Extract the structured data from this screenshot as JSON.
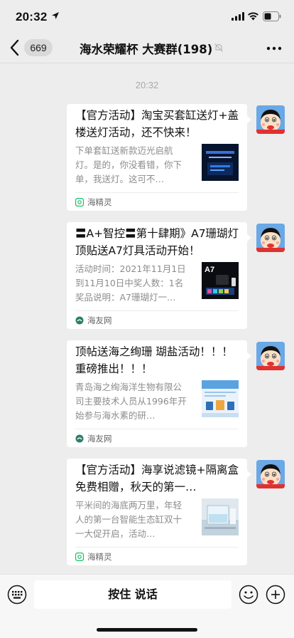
{
  "status_bar": {
    "time": "20:32"
  },
  "nav": {
    "back_label": "",
    "unread_count": "669",
    "title": "海水荣耀杯 大赛群(198)"
  },
  "timestamp": "20:32",
  "messages": [
    {
      "title": "【官方活动】淘宝买套缸送灯+盖楼送灯活动，还不快来！",
      "description": "下单套缸送新款迈光启航灯。是的，你没看错，你下单，我送灯。这可不…",
      "source": "海精灵",
      "thumb_text": "迈光启航 套缸送灯"
    },
    {
      "title": "〓A+智控〓第十肆期》A7珊瑚灯顶贴送A7灯具活动开始！",
      "description": "活动时间：2021年11月1日到11月10日中奖人数：1名奖品说明：A7珊瑚灯一…",
      "source": "海友网",
      "thumb_text": "A7"
    },
    {
      "title": "顶帖送海之绚珊 瑚盐活动！！！ 重磅推出！！！",
      "description": "青岛海之绚海洋生物有限公司主要技术人员从1996年开始参与海水素的研…",
      "source": "海友网",
      "thumb_text": ""
    },
    {
      "title": "【官方活动】海享说滤镜+隔离盒免费相赠，秋天的第一…",
      "description": "平米间的海底两万里，年轻人的第一台智能生态缸双十一大促开启，活动…",
      "source": "海精灵",
      "thumb_text": ""
    }
  ],
  "input_bar": {
    "hold_to_talk": "按住 说话"
  },
  "colors": {
    "background": "#ededed",
    "card": "#ffffff",
    "accent_green": "#07c160"
  }
}
